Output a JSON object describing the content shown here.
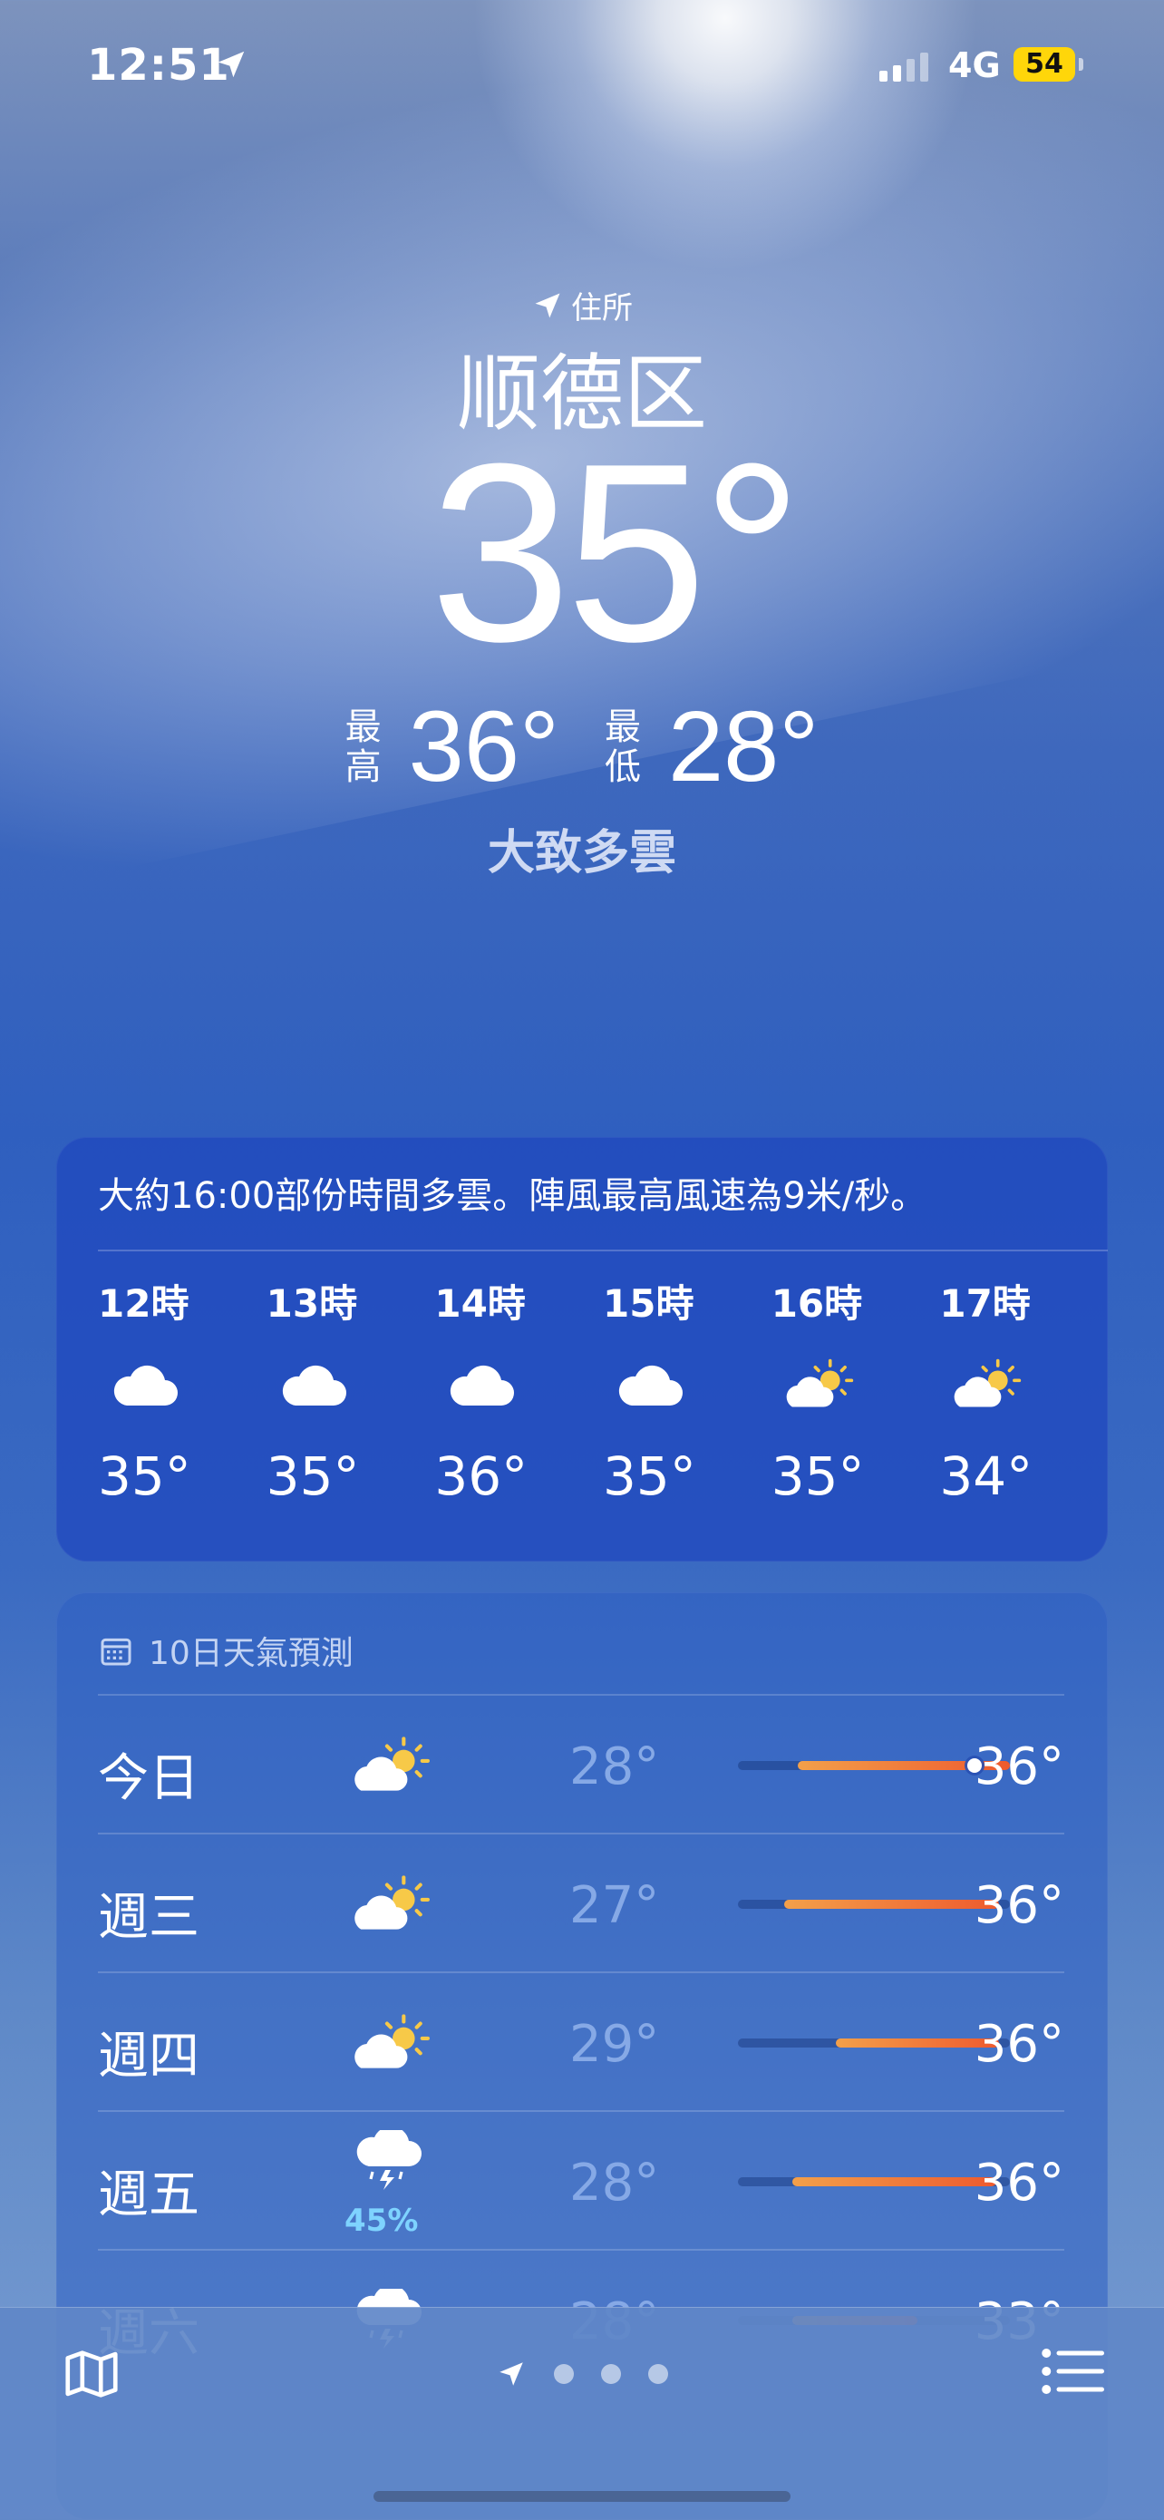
{
  "status_bar": {
    "time": "12:51",
    "network": "4G",
    "battery": "54"
  },
  "location": {
    "label": "住所",
    "city": "顺德区",
    "temperature": "35°",
    "high_label_1": "最",
    "high_label_2": "高",
    "high": "36°",
    "low_label_1": "最",
    "low_label_2": "低",
    "low": "28°",
    "condition": "大致多雲"
  },
  "hourly": {
    "summary": "大約16:00部份時間多雲。陣風最高風速為9米/秒。",
    "items": [
      {
        "hour": "12時",
        "icon": "cloud-icon",
        "temp": "35°"
      },
      {
        "hour": "13時",
        "icon": "cloud-icon",
        "temp": "35°"
      },
      {
        "hour": "14時",
        "icon": "cloud-icon",
        "temp": "36°"
      },
      {
        "hour": "15時",
        "icon": "cloud-icon",
        "temp": "35°"
      },
      {
        "hour": "16時",
        "icon": "partly-sunny-icon",
        "temp": "35°"
      },
      {
        "hour": "17時",
        "icon": "partly-sunny-icon",
        "temp": "34°"
      }
    ]
  },
  "forecast": {
    "title": "10日天氣預測",
    "days": [
      {
        "day": "今日",
        "icon": "partly-sunny-icon",
        "low": "28°",
        "high": "36°",
        "pct": "",
        "bar_start": 0.22,
        "bar_end": 1.0,
        "current": 0.87
      },
      {
        "day": "週三",
        "icon": "partly-sunny-icon",
        "low": "27°",
        "high": "36°",
        "pct": "",
        "bar_start": 0.17,
        "bar_end": 0.96
      },
      {
        "day": "週四",
        "icon": "partly-sunny-icon",
        "low": "29°",
        "high": "36°",
        "pct": "",
        "bar_start": 0.36,
        "bar_end": 0.96
      },
      {
        "day": "週五",
        "icon": "thunderstorm-icon",
        "low": "28°",
        "high": "36°",
        "pct": "45%",
        "bar_start": 0.2,
        "bar_end": 0.95
      },
      {
        "day": "週六",
        "icon": "thunderstorm-icon",
        "low": "28°",
        "high": "33°",
        "pct": "",
        "bar_start": 0.2,
        "bar_end": 0.66
      }
    ]
  },
  "colors": {
    "accent_bar_start": "#f3a04a",
    "accent_bar_end": "#ee5a2e",
    "battery": "#ffd60a",
    "precip": "#7ed3ff"
  }
}
